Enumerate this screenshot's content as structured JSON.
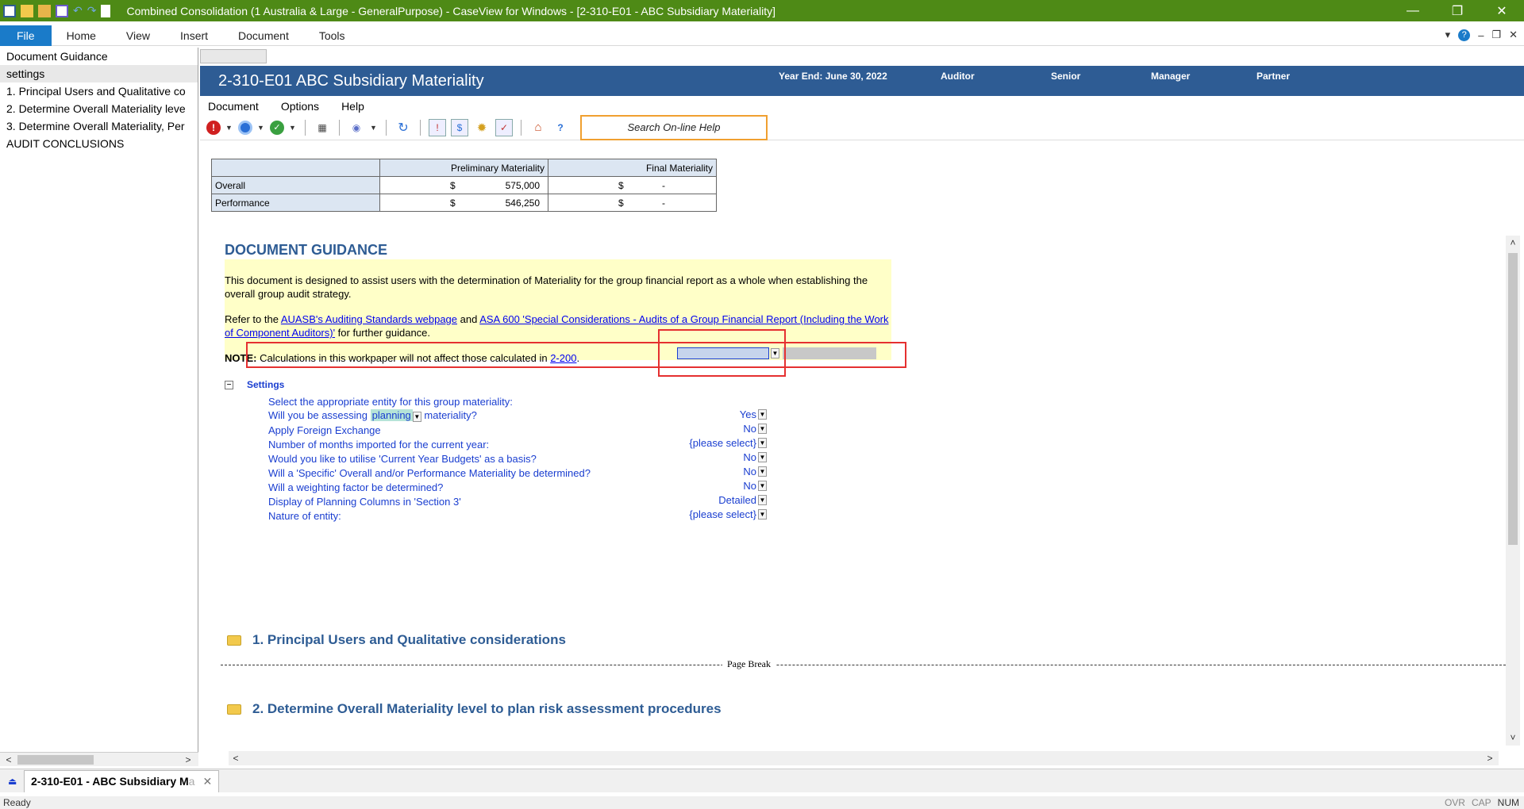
{
  "window": {
    "title": "Combined Consolidation (1 Australia & Large - GeneralPurpose) - CaseView for Windows - [2-310-E01 - ABC Subsidiary Materiality]",
    "minimize": "—",
    "restore": "❐",
    "close": "✕"
  },
  "ribbon": {
    "tabs": [
      "File",
      "Home",
      "View",
      "Insert",
      "Document",
      "Tools"
    ],
    "right_controls": [
      "▾",
      "?",
      "–",
      "❐",
      "✕"
    ]
  },
  "left_nav": {
    "items": [
      "Document Guidance",
      "settings",
      "1. Principal Users and Qualitative co",
      "2. Determine Overall Materiality leve",
      "3. Determine Overall Materiality, Per",
      "AUDIT CONCLUSIONS"
    ],
    "selected_index": 1
  },
  "doc_header": {
    "title": "2-310-E01 ABC Subsidiary Materiality",
    "year_end": "Year End: June 30, 2022",
    "auditor": "Auditor",
    "senior": "Senior",
    "manager": "Manager",
    "partner": "Partner"
  },
  "doc_menu": [
    "Document",
    "Options",
    "Help"
  ],
  "toolbar": {
    "search_placeholder": "Search On-line Help"
  },
  "materiality_table": {
    "headers": [
      "Preliminary Materiality",
      "Final Materiality"
    ],
    "rows": [
      {
        "label": "Overall",
        "prelim_cur": "$",
        "prelim_val": "575,000",
        "final_cur": "$",
        "final_val": "-"
      },
      {
        "label": "Performance",
        "prelim_cur": "$",
        "prelim_val": "546,250",
        "final_cur": "$",
        "final_val": "-"
      }
    ]
  },
  "guidance": {
    "title": "DOCUMENT GUIDANCE",
    "para1": "This document is designed to assist users with the determination of Materiality for the group financial report as a whole when establishing the overall group audit strategy.",
    "para2_prefix": "Refer to the ",
    "link1": "AUASB's Auditing Standards webpage",
    "para2_mid": " and ",
    "link2": "ASA 600 'Special Considerations - Audits of a Group Financial Report (Including the Work of Component Auditors)'",
    "para2_suffix": " for further guidance.",
    "note_label": "NOTE:",
    "note_text": " Calculations in this workpaper will not affect those calculated in ",
    "note_link": "2-200",
    "note_end": "."
  },
  "settings": {
    "heading": "Settings",
    "collapse": "−",
    "rows": [
      {
        "label": "Select the appropriate entity for this group materiality:",
        "value": ""
      },
      {
        "label_pre": "Will you be assessing ",
        "label_hl": "planning",
        "label_post": " materiality?",
        "value": "Yes"
      },
      {
        "label": "Apply Foreign Exchange",
        "value": "No"
      },
      {
        "label": "Number of months imported for the current year:",
        "value": "{please select}"
      },
      {
        "label": "Would you like to utilise 'Current Year Budgets' as a basis?",
        "value": "No"
      },
      {
        "label": "Will a 'Specific' Overall and/or Performance Materiality be determined?",
        "value": "No"
      },
      {
        "label": "Will a weighting factor be determined?",
        "value": "No"
      },
      {
        "label": "Display of Planning Columns in 'Section 3'",
        "value": "Detailed"
      },
      {
        "label": "Nature of entity:",
        "value": "{please select}"
      }
    ]
  },
  "sections": [
    "1. Principal Users and Qualitative considerations",
    "2. Determine Overall Materiality level to plan risk assessment procedures"
  ],
  "page_break_label": "Page Break",
  "bottom_tab": {
    "label": "2-310-E01 - ABC Subsidiary M",
    "fade": "a",
    "close": "✕"
  },
  "status": {
    "ready": "Ready",
    "keys": [
      "OVR",
      "CAP",
      "NUM"
    ]
  },
  "colors": {
    "titlebar": "#4e8a16",
    "header": "#2e5c94",
    "file_tab": "#1a7bc9",
    "guidance_bg": "#ffffc8",
    "highlight_red": "#e53030"
  }
}
